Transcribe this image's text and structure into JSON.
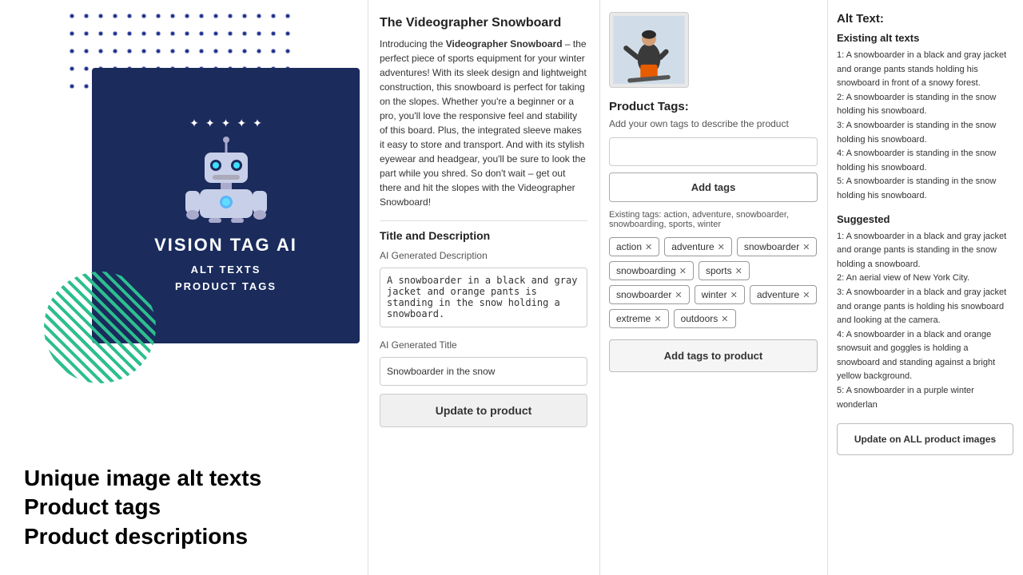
{
  "dots": {
    "color": "#1a2b8c"
  },
  "logo": {
    "title": "VISION TAG AI",
    "subtitle_line1": "ALT TEXTS",
    "subtitle_line2": "PRODUCT TAGS"
  },
  "bottom_text": {
    "line1": "Unique image alt texts",
    "line2": "Product tags",
    "line3": "Product descriptions"
  },
  "product": {
    "title": "The Videographer Snowboard",
    "description_intro": "Introducing the ",
    "description_bold": "Videographer Snowboard",
    "description_rest": " – the perfect piece of sports equipment for your winter adventures! With its sleek design and lightweight construction, this snowboard is perfect for taking on the slopes. Whether you're a beginner or a pro, you'll love the responsive feel and stability of this board. Plus, the integrated sleeve makes it easy to store and transport. And with its stylish eyewear and headgear, you'll be sure to look the part while you shred. So don't wait – get out there and hit the slopes with the Videographer Snowboard!",
    "section_title_and_desc": "Title and Description",
    "ai_generated_desc_label": "AI Generated Description",
    "ai_generated_desc_value": "A snowboarder in a black and gray jacket and orange pants is standing in the snow holding a snowboard.",
    "ai_generated_title_label": "AI Generated Title",
    "ai_generated_title_value": "Snowboarder in the snow",
    "update_btn": "Update to product"
  },
  "product_tags": {
    "panel_title": "Product Tags:",
    "panel_desc": "Add your own tags to describe the product",
    "tag_input_placeholder": "",
    "add_tags_btn": "Add tags",
    "existing_tags_prefix": "Existing tags: action, adventure, snowboarder, snowboarding, sports, winter",
    "tags": [
      {
        "label": "action",
        "id": "tag-action"
      },
      {
        "label": "adventure",
        "id": "tag-adventure"
      },
      {
        "label": "snowboarder",
        "id": "tag-snowboarder-1"
      },
      {
        "label": "snowboarding",
        "id": "tag-snowboarding"
      },
      {
        "label": "sports",
        "id": "tag-sports"
      },
      {
        "label": "snowboarder",
        "id": "tag-snowboarder-2"
      },
      {
        "label": "winter",
        "id": "tag-winter"
      },
      {
        "label": "adventure",
        "id": "tag-adventure-2"
      },
      {
        "label": "extreme",
        "id": "tag-extreme"
      },
      {
        "label": "outdoors",
        "id": "tag-outdoors"
      }
    ],
    "add_to_product_btn": "Add tags to product"
  },
  "alt_text": {
    "section_title": "Alt Text:",
    "existing_title": "Existing alt texts",
    "existing_items": [
      "1: A snowboarder in a black and gray jacket and orange pants stands holding his snowboard in front of a snowy forest.",
      "2: A snowboarder is standing in the snow holding his snowboard.",
      "3: A snowboarder is standing in the snow holding his snowboard.",
      "4: A snowboarder is standing in the snow holding his snowboard.",
      "5: A snowboarder is standing in the snow holding his snowboard."
    ],
    "suggested_title": "Suggested",
    "suggested_items": [
      "1: A snowboarder in a black and gray jacket and orange pants is standing in the snow holding a snowboard.",
      "2: An aerial view of New York City.",
      "3: A snowboarder in a black and gray jacket and orange pants is holding his snowboard and looking at the camera.",
      "4: A snowboarder in a black and orange snowsuit and goggles is holding a snowboard and standing against a bright yellow background.",
      "5: A snowboarder in a purple winter wonderlan"
    ],
    "update_all_btn": "Update on ALL product images"
  }
}
